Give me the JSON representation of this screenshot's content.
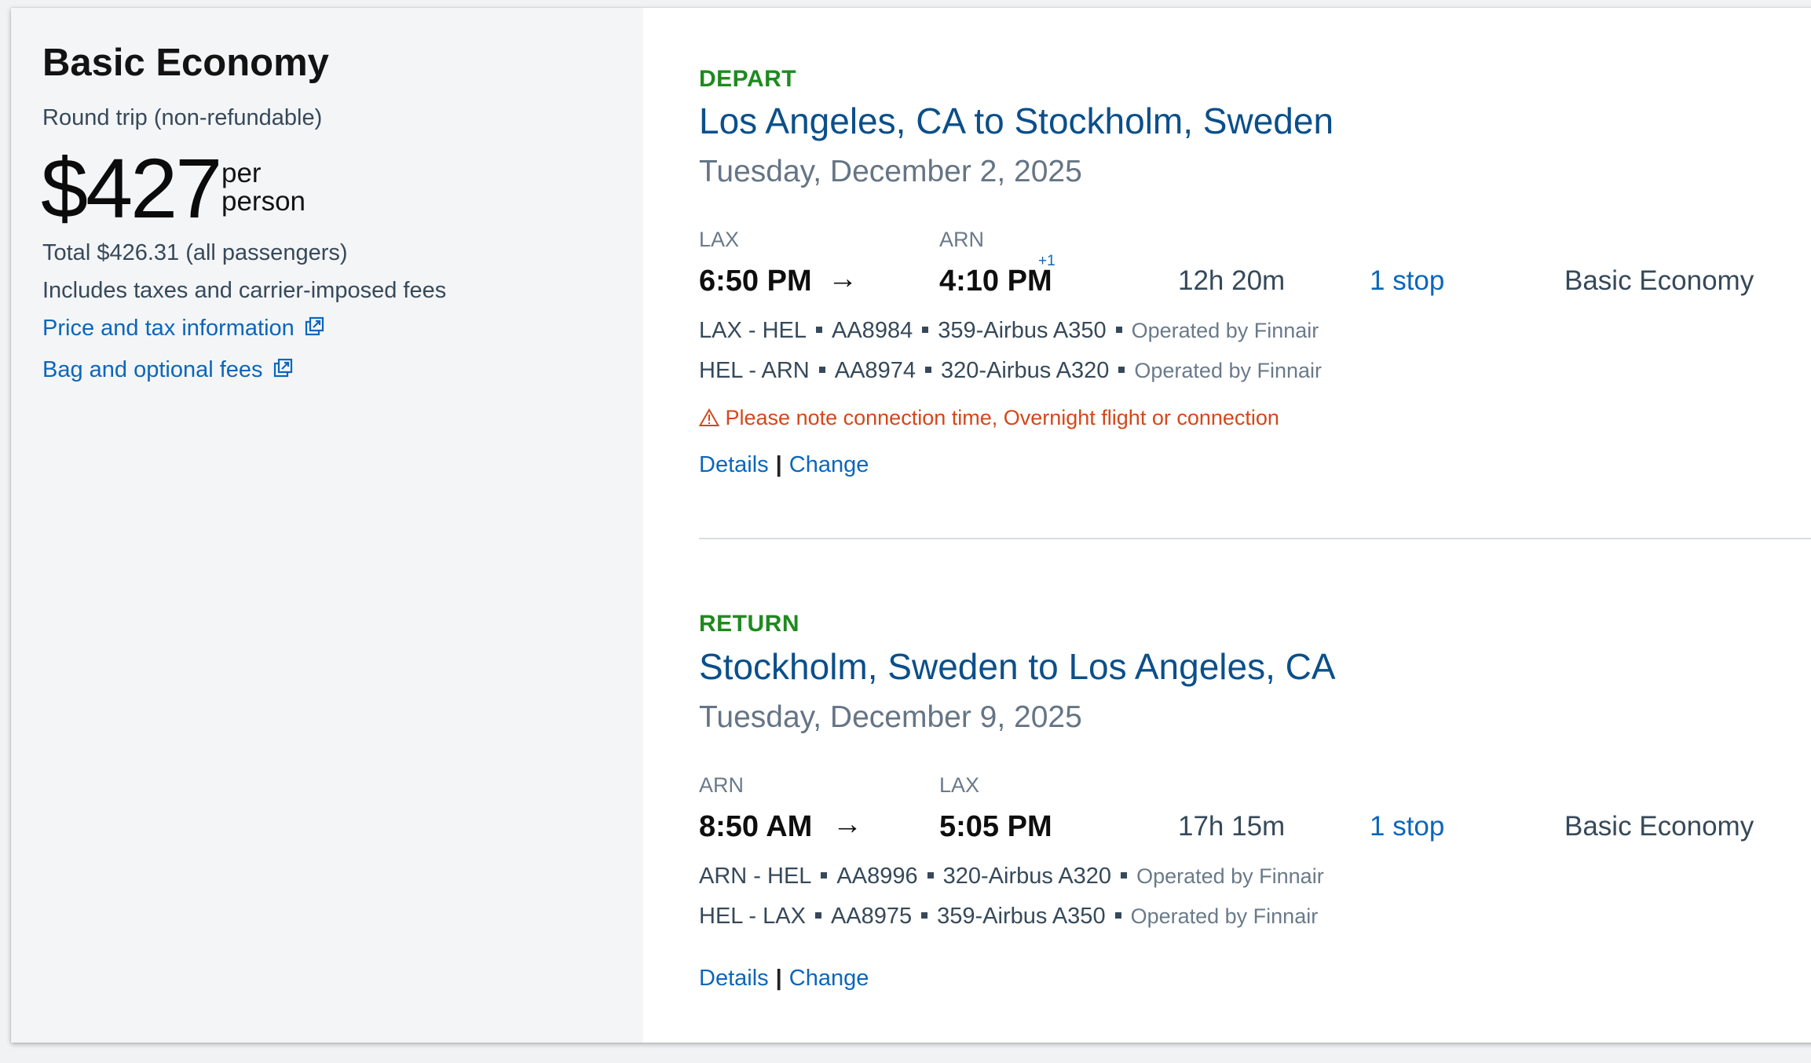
{
  "fare": {
    "title": "Basic Economy",
    "trip_type": "Round trip (non-refundable)",
    "price": "$427",
    "per": "per",
    "person": "person",
    "total": "Total $426.31 (all passengers)",
    "includes": "Includes taxes and carrier-imposed fees",
    "price_tax_link": "Price and tax information",
    "bag_fees_link": "Bag and optional fees",
    "link_icon": "external-link-icon"
  },
  "depart": {
    "label": "DEPART",
    "route": "Los Angeles, CA to Stockholm, Sweden",
    "date": "Tuesday, December 2, 2025",
    "origin": "LAX",
    "destination": "ARN",
    "depart_time": "6:50 PM",
    "arrive_time": "4:10 PM",
    "day_offset": "+1",
    "duration": "12h 20m",
    "stops": "1 stop",
    "cabin": "Basic Economy",
    "segments": [
      {
        "route": "LAX - HEL",
        "flight": "AA8984",
        "aircraft": "359-Airbus A350",
        "operator": "Operated by Finnair"
      },
      {
        "route": "HEL - ARN",
        "flight": "AA8974",
        "aircraft": "320-Airbus A320",
        "operator": "Operated by Finnair"
      }
    ],
    "warning": "Please note connection time, Overnight flight or connection",
    "details": "Details",
    "separator": "|",
    "change": "Change"
  },
  "return": {
    "label": "RETURN",
    "route": "Stockholm, Sweden to Los Angeles, CA",
    "date": "Tuesday, December 9, 2025",
    "origin": "ARN",
    "destination": "LAX",
    "depart_time": "8:50 AM",
    "arrive_time": "5:05 PM",
    "duration": "17h 15m",
    "stops": "1 stop",
    "cabin": "Basic Economy",
    "segments": [
      {
        "route": "ARN - HEL",
        "flight": "AA8996",
        "aircraft": "320-Airbus A320",
        "operator": "Operated by Finnair"
      },
      {
        "route": "HEL - LAX",
        "flight": "AA8975",
        "aircraft": "359-Airbus A350",
        "operator": "Operated by Finnair"
      }
    ],
    "details": "Details",
    "separator": "|",
    "change": "Change"
  },
  "colors": {
    "link": "#0b66bb",
    "route_title": "#0b4f8a",
    "section_label": "#1f8a1f",
    "warning": "#d4471a",
    "left_panel_bg": "#f4f5f7"
  }
}
